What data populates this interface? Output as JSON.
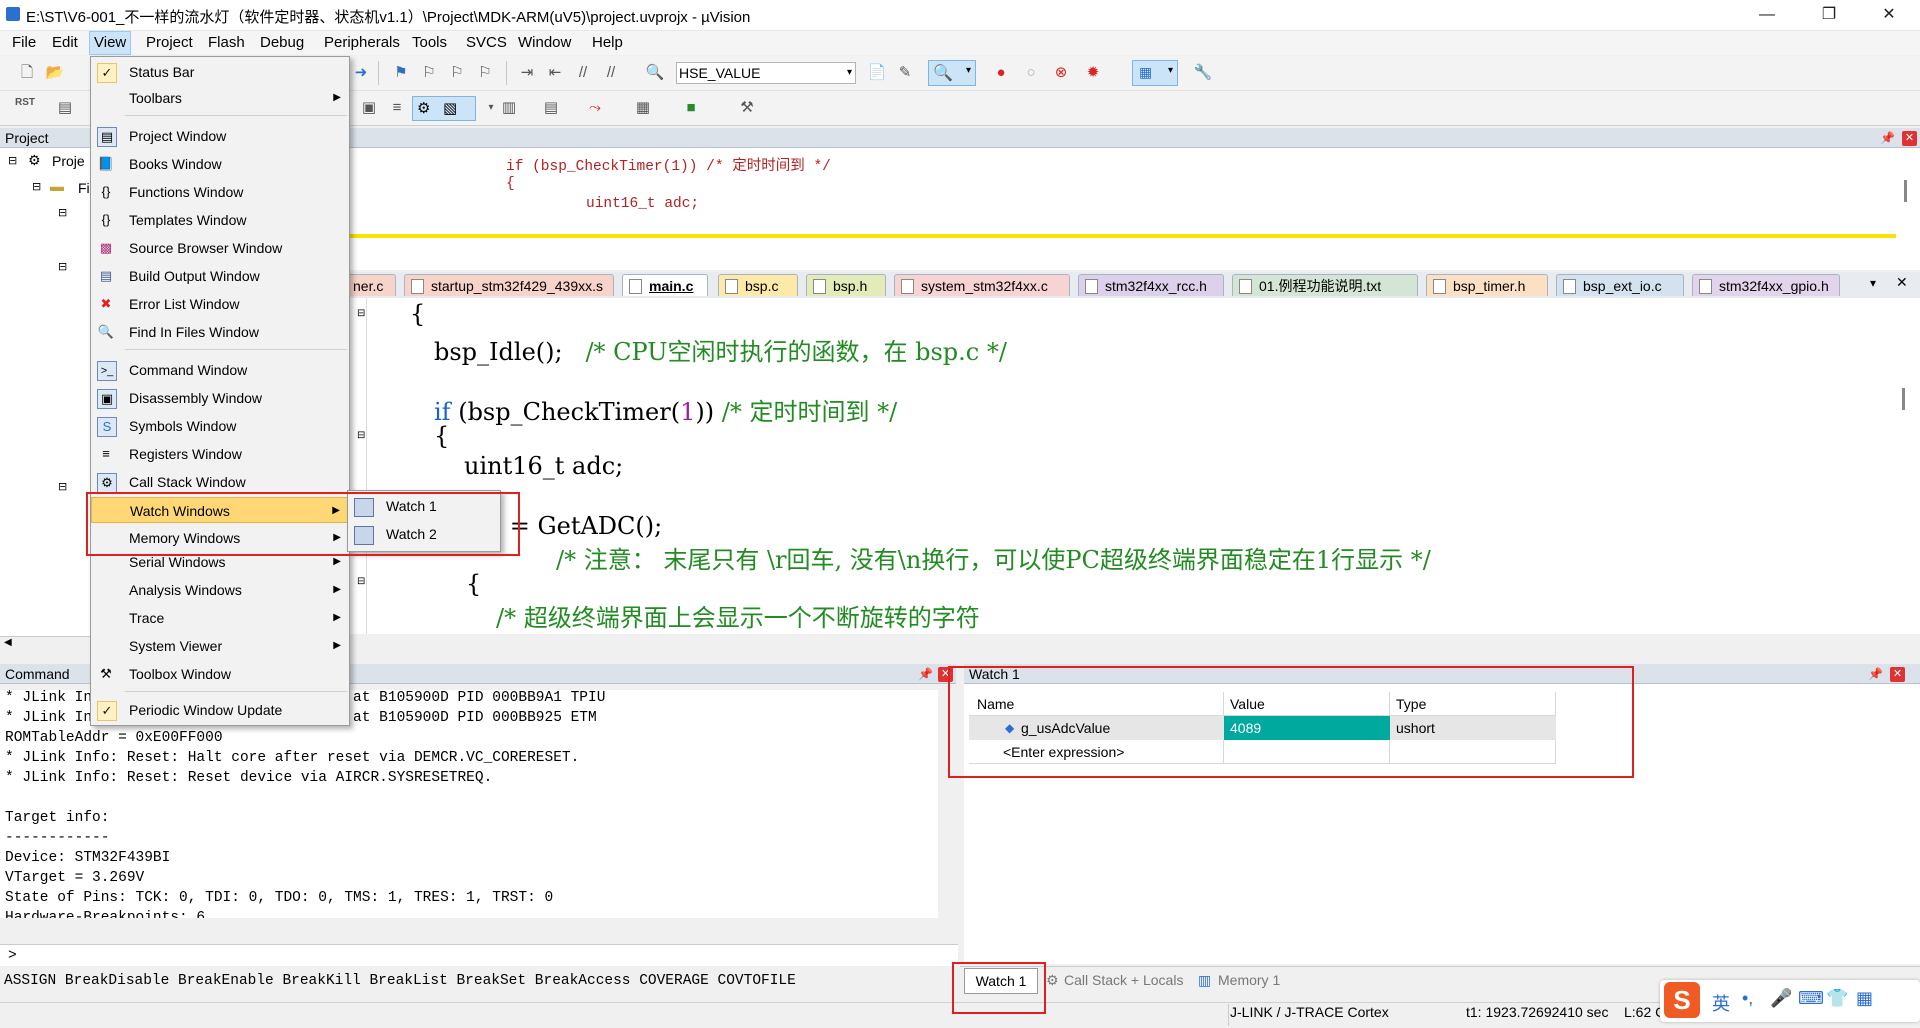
{
  "window": {
    "title": "E:\\ST\\V6-001_不一样的流水灯（软件定时器、状态机v1.1）\\Project\\MDK-ARM(uV5)\\project.uvprojx - µVision",
    "minimize": "—",
    "maximize": "❐",
    "close": "✕"
  },
  "menubar": [
    "File",
    "Edit",
    "View",
    "Project",
    "Flash",
    "Debug",
    "Peripherals",
    "Tools",
    "SVCS",
    "Window",
    "Help"
  ],
  "toolbar": {
    "target_value": "HSE_VALUE",
    "rst_label": "RST"
  },
  "view_menu": {
    "items": [
      {
        "label": "Status Bar",
        "icon": "check-icon"
      },
      {
        "label": "Toolbars",
        "icon": "",
        "submenu": true
      },
      {
        "label": "Project Window",
        "icon": "project-window-icon"
      },
      {
        "label": "Books Window",
        "icon": "books-icon"
      },
      {
        "label": "Functions Window",
        "icon": "braces-icon"
      },
      {
        "label": "Templates Window",
        "icon": "templates-icon"
      },
      {
        "label": "Source Browser Window",
        "icon": "source-browser-icon"
      },
      {
        "label": "Build Output Window",
        "icon": "build-output-icon"
      },
      {
        "label": "Error List Window",
        "icon": "error-icon"
      },
      {
        "label": "Find In Files Window",
        "icon": "find-in-files-icon"
      },
      {
        "label": "Command Window",
        "icon": "command-window-icon"
      },
      {
        "label": "Disassembly Window",
        "icon": "disassembly-icon"
      },
      {
        "label": "Symbols Window",
        "icon": "symbols-icon"
      },
      {
        "label": "Registers Window",
        "icon": "registers-icon"
      },
      {
        "label": "Call Stack Window",
        "icon": "call-stack-icon"
      },
      {
        "label": "Watch Windows",
        "icon": "",
        "submenu": true
      },
      {
        "label": "Memory Windows",
        "icon": "",
        "submenu": true
      },
      {
        "label": "Serial Windows",
        "icon": "",
        "submenu": true
      },
      {
        "label": "Analysis Windows",
        "icon": "",
        "submenu": true
      },
      {
        "label": "Trace",
        "icon": "",
        "submenu": true
      },
      {
        "label": "System Viewer",
        "icon": "",
        "submenu": true
      },
      {
        "label": "Toolbox Window",
        "icon": "toolbox-icon"
      },
      {
        "label": "Periodic Window Update",
        "icon": "check-icon"
      }
    ],
    "watch_submenu": [
      "Watch 1",
      "Watch 2"
    ]
  },
  "project_panel": {
    "title": "Project",
    "tree_root": "Proje",
    "tree_child": "Fi"
  },
  "disasm_code": [
    "if (bsp_CheckTimer(1)) /* 定时时间到 */",
    "{",
    "uint16_t adc;"
  ],
  "file_tabs": [
    "ner.c",
    "startup_stm32f429_439xx.s",
    "main.c",
    "bsp.c",
    "bsp.h",
    "system_stm32f4xx.c",
    "stm32f4xx_rcc.h",
    "01.例程功能说明.txt",
    "bsp_timer.h",
    "bsp_ext_io.c",
    "stm32f4xx_gpio.h"
  ],
  "editor_code": {
    "l1": "{",
    "l2": "bsp_Idle();",
    "l2c": "/* CPU空闲时执行的函数，在 bsp.c */",
    "l3a": "if",
    "l3b": "(bsp_CheckTimer(",
    "l3n": "1",
    "l3d": "))",
    "l3c": "/* 定时时间到 */",
    "l4": "{",
    "l5": "uint16_t adc;",
    "l6": "; = GetADC();",
    "l7": "/* 注意： 末尾只有 \\r回车, 没有\\n换行，可以使PC超级终端界面稳定在1行显示 */",
    "l8": "{",
    "l9": "/* 超级终端界面上会显示一个不断旋转的字符"
  },
  "command_panel": {
    "title": "Command",
    "lines": [
      "* JLink Info: Found Coresight component at B105900D PID 000BB9A1 TPIU",
      "* JLink Info: Found Coresight component at B105900D PID 000BB925 ETM",
      "ROMTableAddr = 0xE00FF000",
      "* JLink Info: Reset: Halt core after reset via DEMCR.VC_CORERESET.",
      "* JLink Info: Reset: Reset device via AIRCR.SYSRESETREQ.",
      "",
      "Target info:",
      "------------",
      "Device: STM32F439BI",
      "VTarget = 3.269V",
      "State of Pins: TCK: 0, TDI: 0, TDO: 0, TMS: 1, TRES: 1, TRST: 0",
      "Hardware-Breakpoints: 6"
    ],
    "prompt": ">",
    "commands": "ASSIGN BreakDisable BreakEnable BreakKill BreakList BreakSet BreakAccess COVERAGE COVTOFILE"
  },
  "watch_panel": {
    "title": "Watch 1",
    "headers": [
      "Name",
      "Value",
      "Type"
    ],
    "rows": [
      {
        "name": "g_usAdcValue",
        "value": "4089",
        "type": "ushort"
      },
      {
        "name": "<Enter expression>",
        "value": "",
        "type": ""
      }
    ],
    "value_highlight": "#00a99d"
  },
  "bottom_tabs": [
    "Watch 1",
    "Call Stack + Locals",
    "Memory 1"
  ],
  "statusbar": {
    "debugger": "J-LINK / J-TRACE Cortex",
    "time": "t1: 1923.72692410 sec",
    "line": "L:62 C:1"
  },
  "ime": {
    "lang": "英"
  },
  "colors": {
    "annotation_red": "#e02020",
    "comment_green": "#228b22",
    "keyword_blue": "#1a5fd0",
    "menu_highlight": "#ffd875"
  }
}
